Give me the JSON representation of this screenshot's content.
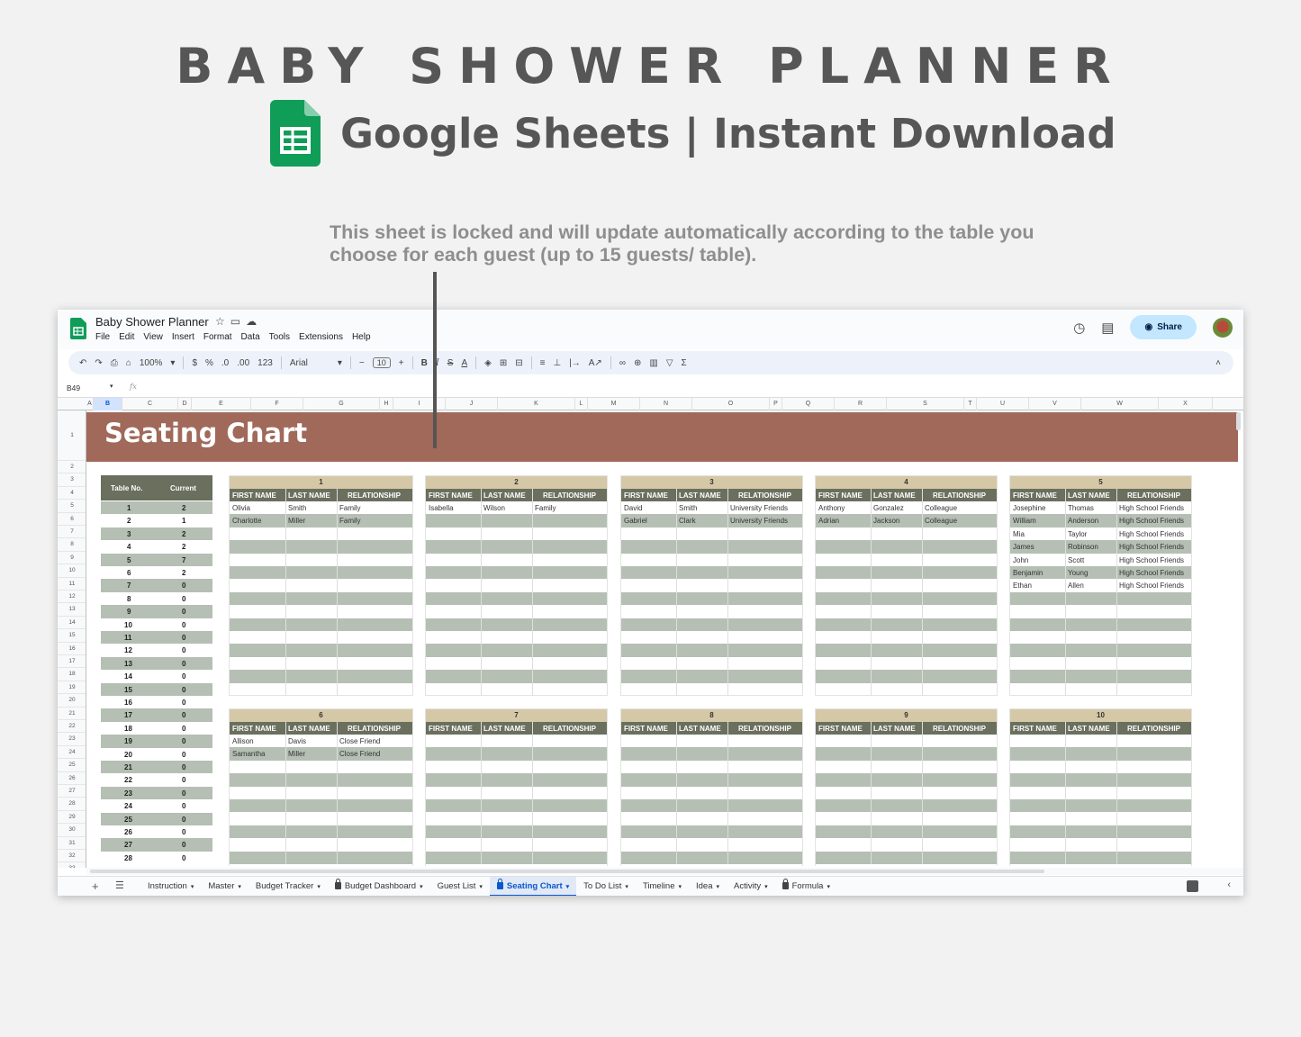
{
  "hero": {
    "title": "BABY SHOWER PLANNER",
    "subtitle": "Google Sheets | Instant Download",
    "note": "This sheet is locked and will update automatically according to the table you choose for each guest (up to 15 guests/ table)."
  },
  "app": {
    "doc_title": "Baby Shower Planner",
    "menu": [
      "File",
      "Edit",
      "View",
      "Insert",
      "Format",
      "Data",
      "Tools",
      "Extensions",
      "Help"
    ],
    "share_label": "Share",
    "zoom": "100%",
    "font": "Arial",
    "font_size": "10",
    "name_box": "B49",
    "fx": "fx"
  },
  "columns": [
    "A",
    "B",
    "C",
    "D",
    "E",
    "F",
    "G",
    "H",
    "I",
    "J",
    "K",
    "L",
    "M",
    "N",
    "O",
    "P",
    "Q",
    "R",
    "S",
    "T",
    "U",
    "V",
    "W",
    "X"
  ],
  "rows": [
    "1",
    "2",
    "3",
    "4",
    "5",
    "6",
    "7",
    "8",
    "9",
    "10",
    "11",
    "12",
    "13",
    "14",
    "15",
    "16",
    "17",
    "18",
    "19",
    "20",
    "21",
    "22",
    "23",
    "24",
    "25",
    "26",
    "27",
    "28",
    "29",
    "30",
    "31",
    "32",
    "33"
  ],
  "sheet": {
    "title": "Seating Chart",
    "table_summary": {
      "header_table": "Table No.",
      "header_current": "Current",
      "rows": [
        {
          "table": "1",
          "current": "2"
        },
        {
          "table": "2",
          "current": "1"
        },
        {
          "table": "3",
          "current": "2"
        },
        {
          "table": "4",
          "current": "2"
        },
        {
          "table": "5",
          "current": "7"
        },
        {
          "table": "6",
          "current": "2"
        },
        {
          "table": "7",
          "current": "0"
        },
        {
          "table": "8",
          "current": "0"
        },
        {
          "table": "9",
          "current": "0"
        },
        {
          "table": "10",
          "current": "0"
        },
        {
          "table": "11",
          "current": "0"
        },
        {
          "table": "12",
          "current": "0"
        },
        {
          "table": "13",
          "current": "0"
        },
        {
          "table": "14",
          "current": "0"
        },
        {
          "table": "15",
          "current": "0"
        },
        {
          "table": "16",
          "current": "0"
        },
        {
          "table": "17",
          "current": "0"
        },
        {
          "table": "18",
          "current": "0"
        },
        {
          "table": "19",
          "current": "0"
        },
        {
          "table": "20",
          "current": "0"
        },
        {
          "table": "21",
          "current": "0"
        },
        {
          "table": "22",
          "current": "0"
        },
        {
          "table": "23",
          "current": "0"
        },
        {
          "table": "24",
          "current": "0"
        },
        {
          "table": "25",
          "current": "0"
        },
        {
          "table": "26",
          "current": "0"
        },
        {
          "table": "27",
          "current": "0"
        },
        {
          "table": "28",
          "current": "0"
        }
      ]
    },
    "guest_headers": [
      "FIRST NAME",
      "LAST NAME",
      "RELATIONSHIP"
    ],
    "tables": [
      {
        "number": "1",
        "guests": [
          [
            "Olivia",
            "Smith",
            "Family"
          ],
          [
            "Charlotte",
            "Miller",
            "Family"
          ]
        ]
      },
      {
        "number": "2",
        "guests": [
          [
            "Isabella",
            "Wilson",
            "Family"
          ]
        ]
      },
      {
        "number": "3",
        "guests": [
          [
            "David",
            "Smith",
            "University Friends"
          ],
          [
            "Gabriel",
            "Clark",
            "University Friends"
          ]
        ]
      },
      {
        "number": "4",
        "guests": [
          [
            "Anthony",
            "Gonzalez",
            "Colleague"
          ],
          [
            "Adrian",
            "Jackson",
            "Colleague"
          ]
        ]
      },
      {
        "number": "5",
        "guests": [
          [
            "Josephine",
            "Thomas",
            "High School Friends"
          ],
          [
            "William",
            "Anderson",
            "High School Friends"
          ],
          [
            "Mia",
            "Taylor",
            "High School Friends"
          ],
          [
            "James",
            "Robinson",
            "High School Friends"
          ],
          [
            "John",
            "Scott",
            "High School Friends"
          ],
          [
            "Benjamin",
            "Young",
            "High School Friends"
          ],
          [
            "Ethan",
            "Allen",
            "High School Friends"
          ]
        ]
      },
      {
        "number": "6",
        "guests": [
          [
            "Allison",
            "Davis",
            "Close Friend"
          ],
          [
            "Samantha",
            "Miller",
            "Close Friend"
          ]
        ]
      },
      {
        "number": "7",
        "guests": []
      },
      {
        "number": "8",
        "guests": []
      },
      {
        "number": "9",
        "guests": []
      },
      {
        "number": "10",
        "guests": []
      }
    ]
  },
  "tabs": [
    {
      "label": "Instruction",
      "locked": false,
      "active": false
    },
    {
      "label": "Master",
      "locked": false,
      "active": false
    },
    {
      "label": "Budget Tracker",
      "locked": false,
      "active": false
    },
    {
      "label": "Budget Dashboard",
      "locked": true,
      "active": false
    },
    {
      "label": "Guest List",
      "locked": false,
      "active": false
    },
    {
      "label": "Seating Chart",
      "locked": true,
      "active": true
    },
    {
      "label": "To Do List",
      "locked": false,
      "active": false
    },
    {
      "label": "Timeline",
      "locked": false,
      "active": false
    },
    {
      "label": "Idea",
      "locked": false,
      "active": false
    },
    {
      "label": "Activity",
      "locked": false,
      "active": false
    },
    {
      "label": "Formula",
      "locked": true,
      "active": false
    }
  ],
  "colors": {
    "banner": "#a0695a",
    "header_dark": "#6a6f5e",
    "table_number": "#d5c8a6",
    "row_alt": "#b5bfb4",
    "sheets_green": "#0f9d58",
    "accent_blue": "#0b57d0"
  },
  "icons": [
    "sheets-logo-icon",
    "star-icon",
    "folder-icon",
    "cloud-icon",
    "history-icon",
    "comment-icon",
    "globe-icon",
    "undo-icon",
    "redo-icon",
    "print-icon",
    "paint-format-icon",
    "bold-icon",
    "italic-icon",
    "strikethrough-icon",
    "text-color-icon",
    "fill-color-icon",
    "borders-icon",
    "merge-icon",
    "align-icon",
    "link-icon",
    "comment-add-icon",
    "chart-icon",
    "filter-icon",
    "function-icon",
    "lock-icon",
    "explore-icon"
  ]
}
